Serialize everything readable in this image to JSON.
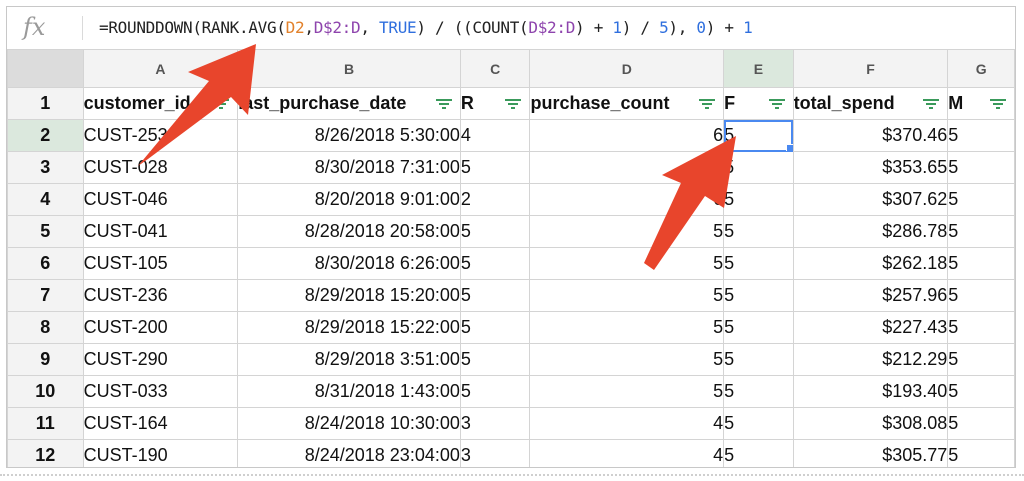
{
  "formula_bar": {
    "fx_label": "fx",
    "formula_parts": {
      "p1": "=ROUNDDOWN(RANK.AVG(",
      "p2": "D2",
      "p3": ",",
      "p4": "D$2:D",
      "p5": ", ",
      "p6": "TRUE",
      "p7": ") / ((COUNT(",
      "p8": "D$2:D",
      "p9": ") + ",
      "p10": "1",
      "p11": ") / ",
      "p12": "5",
      "p13": "), ",
      "p14": "0",
      "p15": ") + ",
      "p16": "1"
    }
  },
  "columns": [
    "A",
    "B",
    "C",
    "D",
    "E",
    "F",
    "G"
  ],
  "active_column": "E",
  "header_row": {
    "row_number": "1",
    "cells": [
      "customer_id",
      "last_purchase_date",
      "R",
      "purchase_count",
      "F",
      "total_spend",
      "M"
    ]
  },
  "rows": [
    {
      "n": "2",
      "customer_id": "CUST-253",
      "date": "8/26/2018 5:30:00",
      "r": "4",
      "count": "6",
      "f": "5",
      "spend": "$370.46",
      "m": "5"
    },
    {
      "n": "3",
      "customer_id": "CUST-028",
      "date": "8/30/2018 7:31:00",
      "r": "5",
      "count": "6",
      "f": "5",
      "spend": "$353.65",
      "m": "5"
    },
    {
      "n": "4",
      "customer_id": "CUST-046",
      "date": "8/20/2018 9:01:00",
      "r": "2",
      "count": "6",
      "f": "5",
      "spend": "$307.62",
      "m": "5"
    },
    {
      "n": "5",
      "customer_id": "CUST-041",
      "date": "8/28/2018 20:58:00",
      "r": "5",
      "count": "5",
      "f": "5",
      "spend": "$286.78",
      "m": "5"
    },
    {
      "n": "6",
      "customer_id": "CUST-105",
      "date": "8/30/2018 6:26:00",
      "r": "5",
      "count": "5",
      "f": "5",
      "spend": "$262.18",
      "m": "5"
    },
    {
      "n": "7",
      "customer_id": "CUST-236",
      "date": "8/29/2018 15:20:00",
      "r": "5",
      "count": "5",
      "f": "5",
      "spend": "$257.96",
      "m": "5"
    },
    {
      "n": "8",
      "customer_id": "CUST-200",
      "date": "8/29/2018 15:22:00",
      "r": "5",
      "count": "5",
      "f": "5",
      "spend": "$227.43",
      "m": "5"
    },
    {
      "n": "9",
      "customer_id": "CUST-290",
      "date": "8/29/2018 3:51:00",
      "r": "5",
      "count": "5",
      "f": "5",
      "spend": "$212.29",
      "m": "5"
    },
    {
      "n": "10",
      "customer_id": "CUST-033",
      "date": "8/31/2018 1:43:00",
      "r": "5",
      "count": "5",
      "f": "5",
      "spend": "$193.40",
      "m": "5"
    },
    {
      "n": "11",
      "customer_id": "CUST-164",
      "date": "8/24/2018 10:30:00",
      "r": "3",
      "count": "4",
      "f": "5",
      "spend": "$308.08",
      "m": "5"
    },
    {
      "n": "12",
      "customer_id": "CUST-190",
      "date": "8/24/2018 23:04:00",
      "r": "3",
      "count": "4",
      "f": "5",
      "spend": "$305.77",
      "m": "5"
    }
  ],
  "selected_cell": "E2",
  "colors": {
    "annotation_arrow": "#e8452c",
    "selection": "#4a89f0",
    "filter_icon": "#3a9a5b",
    "active_header": "#dbe8dd"
  },
  "icons": {
    "formula": "fx-icon",
    "filter": "filter-icon",
    "annotation": "arrow-icon"
  }
}
